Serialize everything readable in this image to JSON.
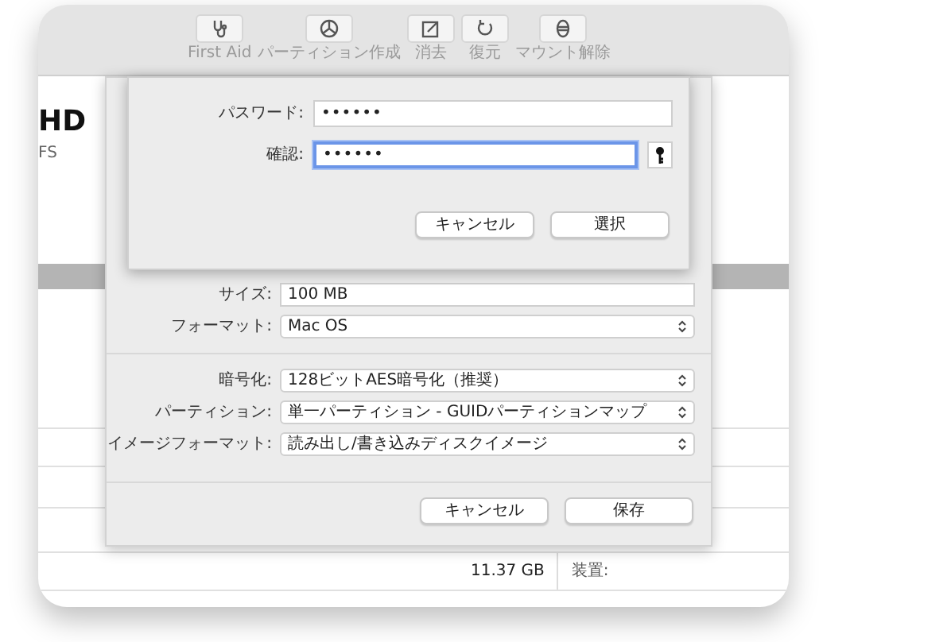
{
  "toolbar": [
    {
      "label": "First Aid"
    },
    {
      "label": "パーティション作成"
    },
    {
      "label": "消去"
    },
    {
      "label": "復元"
    },
    {
      "label": "マウント解除"
    }
  ],
  "disk": {
    "title": "HD",
    "subtitle": "FS"
  },
  "footer": {
    "capacity": "11.37 GB",
    "device_label": "装置:"
  },
  "save_sheet": {
    "fields": [
      {
        "kind": "text",
        "label": "サイズ:",
        "value": "100 MB"
      },
      {
        "kind": "popup",
        "label": "フォーマット:",
        "value": "Mac OS"
      },
      {
        "kind": "divider"
      },
      {
        "kind": "popup",
        "label": "暗号化:",
        "value": "128ビットAES暗号化（推奨）"
      },
      {
        "kind": "popup",
        "label": "パーティション:",
        "value": "単一パーティション - GUIDパーティションマップ"
      },
      {
        "kind": "popup",
        "label": "イメージフォーマット:",
        "value": "読み出し/書き込みディスクイメージ"
      }
    ],
    "buttons": [
      "キャンセル",
      "保存"
    ]
  },
  "password_sheet": {
    "fields": [
      {
        "label": "パスワード:",
        "value": "••••••",
        "focused": false,
        "key_button": false
      },
      {
        "label": "確認:",
        "value": "••••••",
        "focused": true,
        "key_button": true
      }
    ],
    "buttons": [
      "キャンセル",
      "選択"
    ]
  }
}
